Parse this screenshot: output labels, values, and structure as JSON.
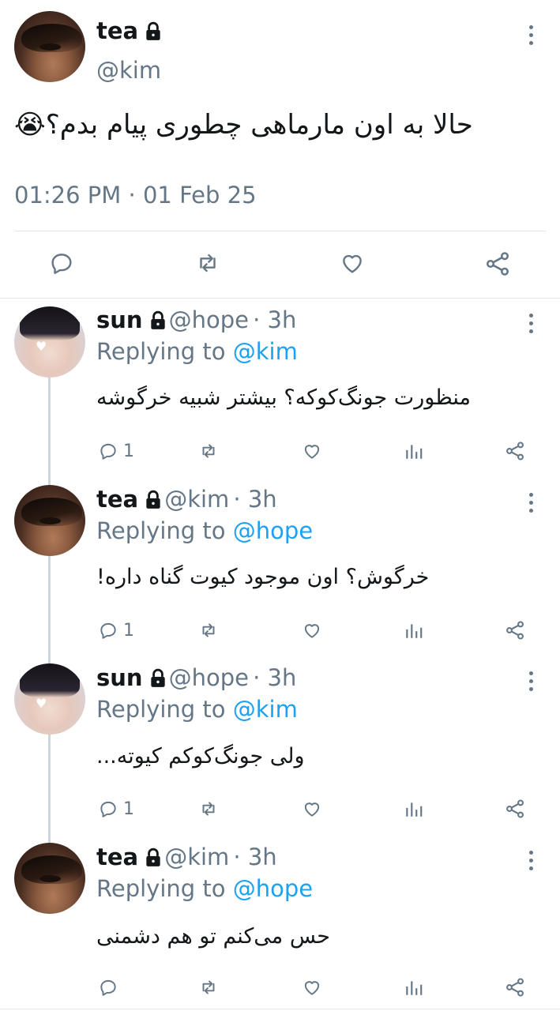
{
  "main_tweet": {
    "name": "tea",
    "handle": "@kim",
    "text": "حالا به اون مارماهی چطوری پیام بدم؟😭",
    "timestamp": "01:26 PM · 01 Feb 25"
  },
  "replies": [
    {
      "name": "sun",
      "handle": "@hope",
      "time": "· 3h",
      "replying_label": "Replying to",
      "replying_to": "@kim",
      "text": "منظورت جونگ‌کوکه؟ بیشتر شبیه خرگوشه",
      "reply_count": "1"
    },
    {
      "name": "tea",
      "handle": "@kim",
      "time": "· 3h",
      "replying_label": "Replying to",
      "replying_to": "@hope",
      "text": "خرگوش؟ اون موجود کیوت گناه داره!",
      "reply_count": "1"
    },
    {
      "name": "sun",
      "handle": "@hope",
      "time": "· 3h",
      "replying_label": "Replying to",
      "replying_to": "@kim",
      "text": "ولی جونگ‌کوکم کیوته...",
      "reply_count": "1"
    },
    {
      "name": "tea",
      "handle": "@kim",
      "time": "· 3h",
      "replying_label": "Replying to",
      "replying_to": "@hope",
      "text": "حس می‌کنم تو هم دشمنی",
      "reply_count": ""
    }
  ],
  "colors": {
    "accent": "#1da1f2",
    "icon": "#657786",
    "text": "#14171a",
    "divider": "#e1e8ed"
  },
  "icons": [
    "lock-icon",
    "more-icon",
    "reply-icon",
    "retweet-icon",
    "like-icon",
    "share-icon",
    "stats-icon"
  ]
}
